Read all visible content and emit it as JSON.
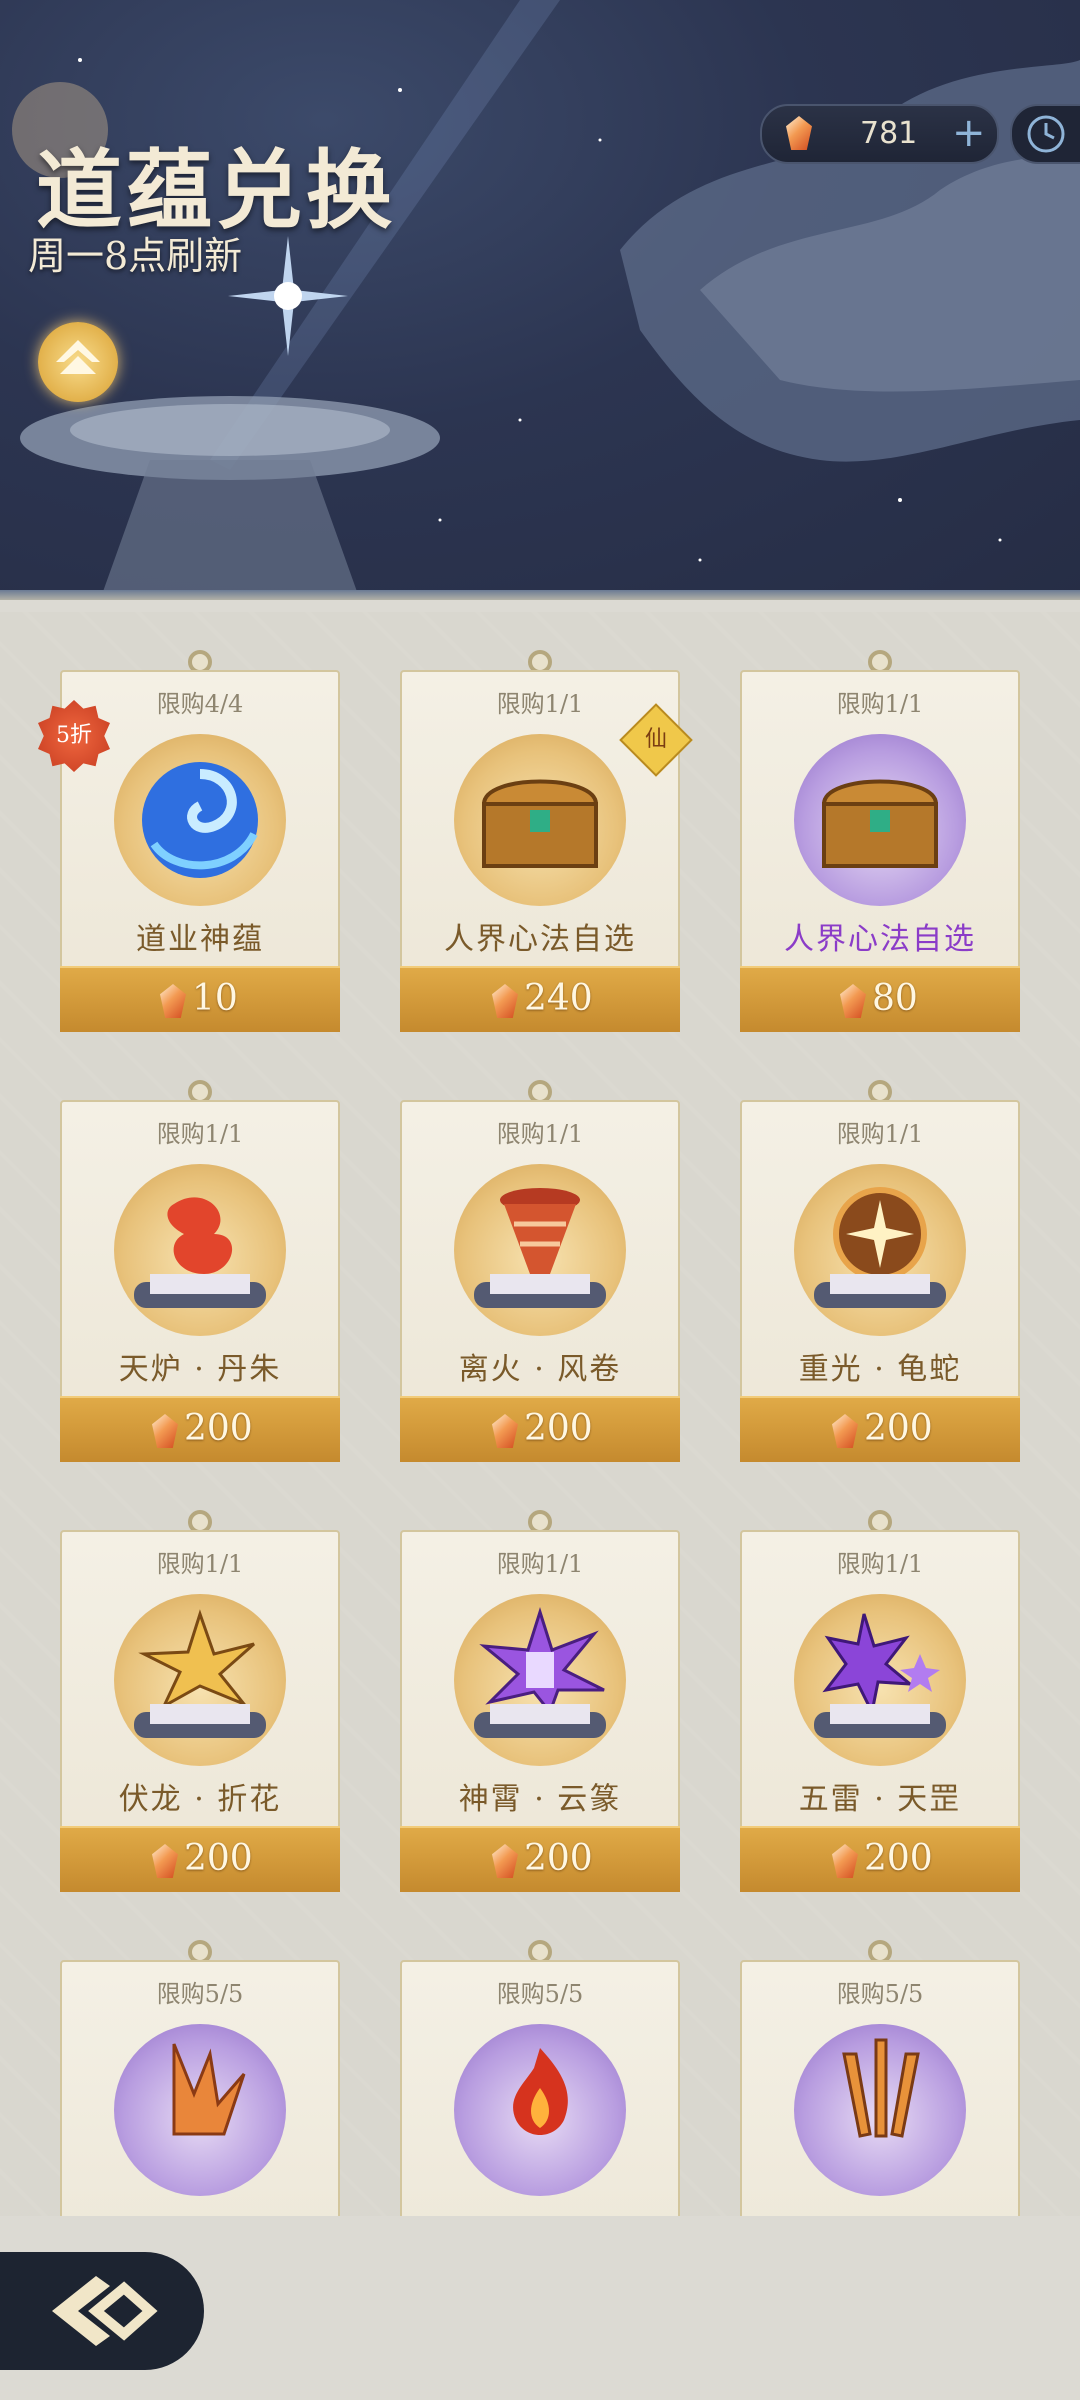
{
  "header": {
    "title": "道蕴兑换",
    "subtitle": "周一8点刷新",
    "currency_value": "781",
    "plus_label": "+"
  },
  "cards": [
    {
      "limit": "限购4/4",
      "name": "道业神蕴",
      "price": "10",
      "badge": "5折",
      "art": "blue-swirl-orb"
    },
    {
      "limit": "限购1/1",
      "name": "人界心法自选",
      "price": "240",
      "tag": "仙",
      "art": "treasure-chest"
    },
    {
      "limit": "限购1/1",
      "name": "人界心法自选",
      "price": "80",
      "art": "treasure-chest-purple"
    },
    {
      "limit": "限购1/1",
      "name": "天炉 · 丹朱",
      "price": "200",
      "art": "red-flame-scroll"
    },
    {
      "limit": "限购1/1",
      "name": "离火 · 风卷",
      "price": "200",
      "art": "fire-tornado-scroll"
    },
    {
      "limit": "限购1/1",
      "name": "重光 · 龟蛇",
      "price": "200",
      "art": "golden-burst-scroll"
    },
    {
      "limit": "限购1/1",
      "name": "伏龙 · 折花",
      "price": "200",
      "art": "lightning-gold-scroll"
    },
    {
      "limit": "限购1/1",
      "name": "神霄 · 云篆",
      "price": "200",
      "art": "purple-thunder-scroll"
    },
    {
      "limit": "限购1/1",
      "name": "五雷 · 天罡",
      "price": "200",
      "art": "purple-star-scroll"
    },
    {
      "limit": "限购5/5",
      "name": "",
      "price": "",
      "art": "flame-claw-scroll"
    },
    {
      "limit": "限购5/5",
      "name": "",
      "price": "",
      "art": "red-fire-scroll"
    },
    {
      "limit": "限购5/5",
      "name": "",
      "price": "",
      "art": "triple-blade-scroll"
    }
  ],
  "icons": {
    "currency": "crystal-gem-icon",
    "clock": "clock-icon",
    "rank": "rank-up-icon",
    "back": "back-arrow-icon"
  },
  "colors": {
    "price_bar": "#d29a3a",
    "header_bg": "#2c3551",
    "name_text": "#7a5a2a",
    "name_purple": "#8b3cc8"
  }
}
